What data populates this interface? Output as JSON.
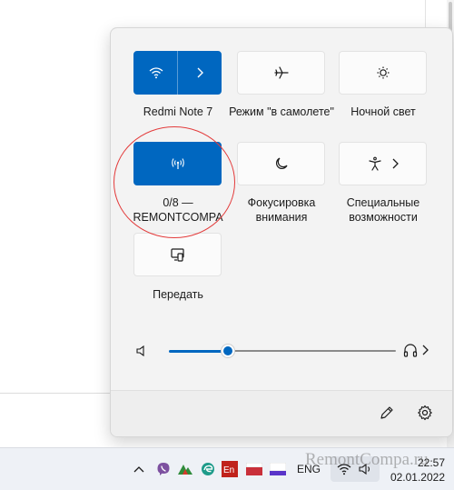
{
  "quick_settings": {
    "tiles": [
      {
        "id": "wifi",
        "label": "Redmi Note 7",
        "icon": "wifi-icon",
        "active": true
      },
      {
        "id": "airplane",
        "label": "Режим \"в самолете\"",
        "icon": "airplane-icon",
        "active": false
      },
      {
        "id": "night",
        "label": "Ночной свет",
        "icon": "night-light-icon",
        "active": false
      },
      {
        "id": "hotspot",
        "label": "0/8 — REMONTCOMPA",
        "icon": "mobile-hotspot-icon",
        "active": true
      },
      {
        "id": "focus",
        "label": "Фокусировка внимания",
        "icon": "moon-icon",
        "active": false
      },
      {
        "id": "accessibility",
        "label": "Специальные возможности",
        "icon": "accessibility-icon",
        "active": false
      },
      {
        "id": "cast",
        "label": "Передать",
        "icon": "cast-icon",
        "active": false
      }
    ],
    "volume": {
      "level_percent": 30,
      "icon": "speaker-icon",
      "output_icon": "headphones-icon"
    },
    "footer": {
      "edit_icon": "pencil-icon",
      "settings_icon": "gear-icon"
    }
  },
  "taskbar": {
    "language": "ENG",
    "time": "22:57",
    "date": "02.01.2022",
    "tray_icons": [
      "chevron-up-icon",
      "viber-icon",
      "app-icon",
      "edge-icon",
      "en-icon",
      "app-icon",
      "app-icon",
      "wifi-icon",
      "speaker-icon"
    ]
  },
  "watermark": "RemontCompa.ru",
  "colors": {
    "accent": "#0067c0",
    "annotation": "#e33b3b"
  }
}
